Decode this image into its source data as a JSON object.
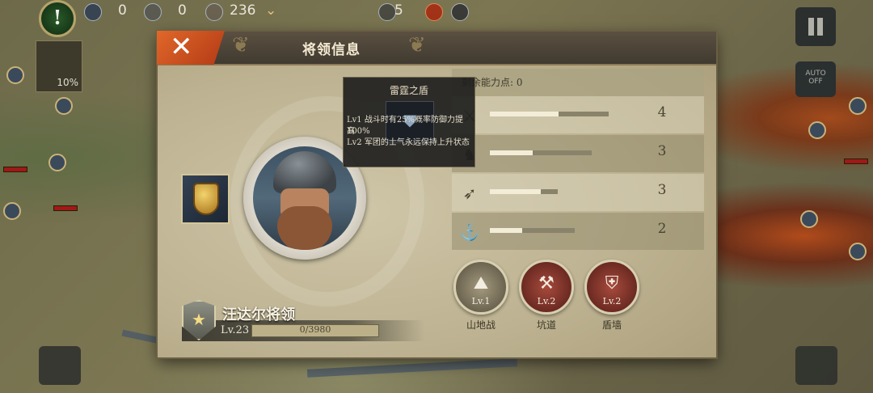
{
  "hud": {
    "alert_symbol": "!",
    "count_a": "0",
    "count_b": "0",
    "resource": "236",
    "hand_count": "5",
    "auto_label": "AUTO",
    "auto_state": "OFF",
    "side_tile_pct": "10%"
  },
  "dialog": {
    "title": "将领信息",
    "close_symbol": "✕"
  },
  "general": {
    "name": "汪达尔将领",
    "level": "Lv.23",
    "xp": "0/3980"
  },
  "stats": {
    "remaining_points": "剩余能力点:  0",
    "rows": [
      {
        "icon": "sword-icon",
        "glyph": "⚔",
        "value": "4",
        "fill": 0.58
      },
      {
        "icon": "horse-icon",
        "glyph": "♞",
        "value": "3",
        "fill": 0.42
      },
      {
        "icon": "bow-icon",
        "glyph": "➶",
        "value": "3",
        "fill": 0.75
      },
      {
        "icon": "anchor-icon",
        "glyph": "⚓",
        "value": "2",
        "fill": 0.38
      }
    ]
  },
  "skills": [
    {
      "name": "山地战",
      "level": "Lv.1",
      "glyph": "⛰"
    },
    {
      "name": "坑道",
      "level": "Lv.2",
      "glyph": "⚒"
    },
    {
      "name": "盾墙",
      "level": "Lv.2",
      "glyph": "⛨"
    }
  ],
  "tooltip": {
    "title": "雷霆之盾",
    "line1": "Lv1  战斗时有25%概率防御力提高",
    "line2": "100%",
    "line3": "Lv2  军团的士气永远保持上升状态"
  },
  "colors": {
    "close_button": "#d2542a",
    "dialog_bg": "#bdb291",
    "header_bg": "#4a4238"
  }
}
